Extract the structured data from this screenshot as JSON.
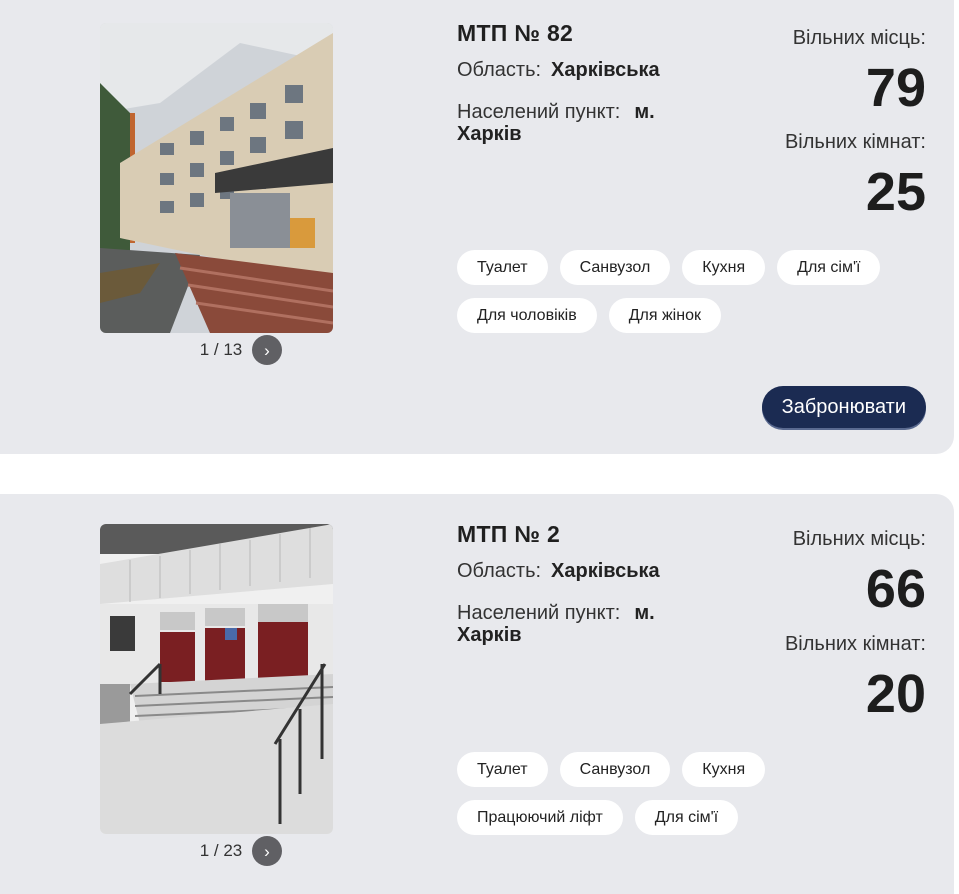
{
  "cards": [
    {
      "title": "МТП № 82",
      "region_label": "Область:",
      "region_value": "Харківська",
      "settlement_label": "Населений пункт:",
      "settlement_value": "м. Харків",
      "free_places_label": "Вільних місць:",
      "free_places_value": "79",
      "free_rooms_label": "Вільних кімнат:",
      "free_rooms_value": "25",
      "pager": "1 / 13",
      "tags": [
        "Туалет",
        "Санвузол",
        "Кухня",
        "Для сім'ї",
        "Для чоловіків",
        "Для жінок"
      ],
      "book_label": "Забронювати"
    },
    {
      "title": "МТП № 2",
      "region_label": "Область:",
      "region_value": "Харківська",
      "settlement_label": "Населений пункт:",
      "settlement_value": "м. Харків",
      "free_places_label": "Вільних місць:",
      "free_places_value": "66",
      "free_rooms_label": "Вільних кімнат:",
      "free_rooms_value": "20",
      "pager": "1 / 23",
      "tags": [
        "Туалет",
        "Санвузол",
        "Кухня",
        "Працюючий ліфт",
        "Для сім'ї"
      ]
    }
  ],
  "icons": {
    "next": "chevron-right-icon"
  }
}
